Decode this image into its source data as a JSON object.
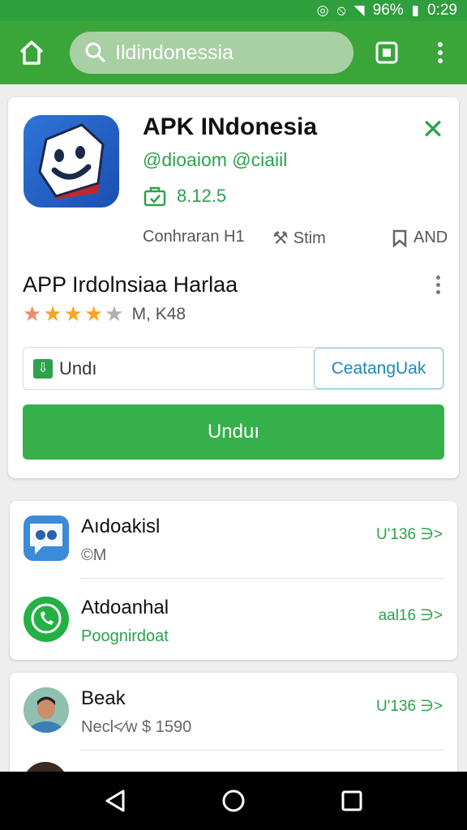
{
  "status_bar": {
    "battery": "96%",
    "time": "0:29"
  },
  "search": {
    "query": "Ildindonessia"
  },
  "app": {
    "title": "APK INdonesia",
    "developer": "@dioaiom @ciaiil",
    "version": "8.12.5",
    "meta": [
      {
        "label": "Conhraran H1",
        "icon": "info-icon"
      },
      {
        "label": "Stim",
        "icon": "hammer-icon"
      },
      {
        "label": "AND",
        "icon": "bookmark-icon"
      }
    ],
    "subtitle": "APP Irdolnsiaa Harlaa",
    "rating": 4,
    "rating_max": 5,
    "reviews": "M, K48",
    "segment_left": "Undı",
    "segment_right": "CeatangUak",
    "download_label": "Unduı"
  },
  "list1": [
    {
      "title": "Aıdoakisl",
      "sub": "©M",
      "action": "U'136 ∋>",
      "icon": "chat-app-icon"
    },
    {
      "title": "Atdoanhal",
      "sub": "Poognirdoat",
      "action": "aal16 ∋>",
      "icon": "whatsapp-icon"
    }
  ],
  "list2": [
    {
      "title": "Beak",
      "sub": "Necl<∕w $ 1590",
      "action": "U'136 ∋>",
      "icon": "avatar"
    }
  ],
  "colors": {
    "brand": "#3aa63a",
    "accent": "#2ba24c",
    "download": "#35b04a"
  }
}
